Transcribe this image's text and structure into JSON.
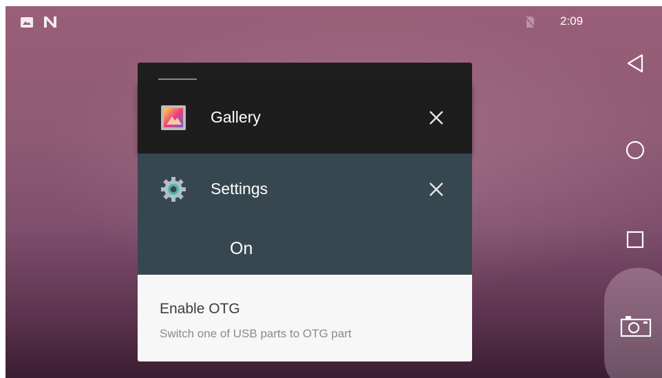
{
  "status_bar": {
    "time": "2:09",
    "left_icons": [
      "image-notification-icon",
      "n-notification-icon"
    ],
    "right_icons": [
      "no-sim-icon"
    ]
  },
  "nav_bar": {
    "buttons": [
      "back-icon",
      "home-icon",
      "recents-icon",
      "camera-icon"
    ]
  },
  "recents": {
    "cards": [
      {
        "app": "Gallery",
        "icon": "gallery-icon",
        "close_icon": "close-icon"
      },
      {
        "app": "Settings",
        "icon": "settings-gear-icon",
        "close_icon": "close-icon"
      }
    ],
    "settings_preview": {
      "value": "On",
      "option_title": "Enable OTG",
      "option_subtitle": "Switch one of USB parts to OTG part"
    }
  },
  "colors": {
    "card_dark": "#1d1d1d",
    "settings_header": "#36474f",
    "preview_bg": "#f7f7f7",
    "wallpaper": "#8e5a74"
  }
}
